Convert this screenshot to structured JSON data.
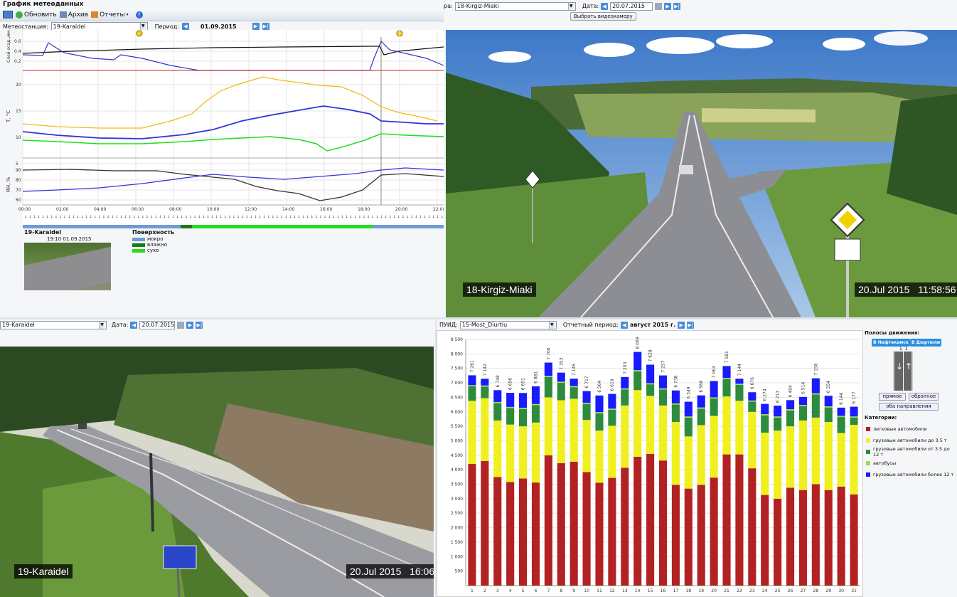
{
  "meteo": {
    "title": "График метеоданных",
    "toolbar": {
      "refresh": "Обновить",
      "archive": "Архив",
      "reports": "Отчеты"
    },
    "station_label": "Метеостанция:",
    "station": "19-Karaidel",
    "period_label": "Период:",
    "period": "01.09.2015",
    "axis1": "Слой осад.,мм",
    "axis2": "T, °C",
    "axis3": "RH, %",
    "times": [
      "00:00",
      "02:00",
      "04:00",
      "06:00",
      "08:00",
      "10:00",
      "12:00",
      "14:00",
      "16:00",
      "18:00",
      "20:00",
      "22:00"
    ],
    "y1": [
      "0.6",
      "0.4",
      "0.2"
    ],
    "y2": [
      "20",
      "15",
      "10",
      "5"
    ],
    "y3": [
      "90",
      "80",
      "70",
      "60"
    ],
    "info": {
      "station": "19-Karaidel",
      "time": "19:10 01.09.2015"
    },
    "legend": {
      "title": "Поверхность",
      "items": [
        {
          "label": "мокро",
          "color": "#6f9bd8"
        },
        {
          "label": "влажно",
          "color": "#1a7a1a"
        },
        {
          "label": "сухо",
          "color": "#22dd22"
        }
      ]
    }
  },
  "cam1": {
    "label_prefix": "ра:",
    "camera": "18-Kirgiz-Miaki",
    "date_label": "Дата:",
    "date": "20.07.2015",
    "select_btn": "Выбрать видеокамеру",
    "overlay_name": "18-Kirgiz-Miaki",
    "overlay_date": "20.Jul 2015",
    "overlay_time": "11:58:56"
  },
  "cam2": {
    "camera": "19-Karaidel",
    "date_label": "Дата:",
    "date": "20.07.2015",
    "overlay_name": "19-Karaidel",
    "overlay_date": "20.Jul 2015",
    "overlay_time": "16:06:29"
  },
  "traffic": {
    "station_label": "ПУИД:",
    "station": "15-Most_Diurtiu",
    "period_label": "Отчетный период:",
    "period": "август 2015 г.",
    "lanes_title": "Полосы движения:",
    "dir1": "В Нефтекамск",
    "dir2": "В Дюртюли",
    "lane_nums": [
      "1",
      "1"
    ],
    "btn_forward": "прямое",
    "btn_back": "обратное",
    "btn_both": "оба направления",
    "cat_title": "Категории:",
    "categories": [
      {
        "label": "легковые автомобили",
        "color": "#b22222"
      },
      {
        "label": "грузовые автомобили до 3.5 т",
        "color": "#f0f020"
      },
      {
        "label": "грузовые автомобили от 3.5 до 12 т",
        "color": "#2e8b3e"
      },
      {
        "label": "автобусы",
        "color": "#99dd55"
      },
      {
        "label": "грузовые автомобили более 12 т",
        "color": "#1a1aff"
      }
    ],
    "y_ticks": [
      "8 500",
      "8 000",
      "7 500",
      "7 000",
      "6 500",
      "6 000",
      "5 500",
      "5 000",
      "4 500",
      "4 000",
      "3 500",
      "3 000",
      "2 500",
      "2 000",
      "1 500",
      "1 000",
      "500"
    ]
  },
  "chart_data": {
    "type": "bar",
    "stacked": true,
    "ylim": [
      0,
      8500
    ],
    "categories": [
      "1",
      "2",
      "3",
      "4",
      "5",
      "6",
      "7",
      "8",
      "9",
      "10",
      "11",
      "12",
      "13",
      "14",
      "15",
      "16",
      "17",
      "18",
      "19",
      "20",
      "21",
      "22",
      "23",
      "24",
      "25",
      "26",
      "27",
      "28",
      "29",
      "30",
      "31"
    ],
    "totals": [
      "7 261",
      "7 142",
      "6 748",
      "6 656",
      "6 651",
      "6 881",
      "7 700",
      "7 353",
      "7 145",
      "6 717",
      "6 564",
      "6 619",
      "7 203",
      "8 069",
      "7 628",
      "7 257",
      "6 738",
      "6 349",
      "6 568",
      "7 063",
      "7 581",
      "7 144",
      "6 676",
      "6 274",
      "6 213",
      "6 404",
      "6 514",
      "7 158",
      "6 554",
      "6 144",
      "6 177"
    ],
    "series": [
      {
        "name": "легковые автомобили",
        "values": [
          4200,
          4300,
          3750,
          3580,
          3700,
          3560,
          4500,
          4230,
          4280,
          3920,
          3550,
          3720,
          4070,
          4450,
          4550,
          4320,
          3480,
          3350,
          3480,
          3730,
          4530,
          4530,
          4050,
          3130,
          3000,
          3380,
          3300,
          3500,
          3300,
          3420,
          3150
        ]
      },
      {
        "name": "грузовые автомобили до 3.5 т",
        "values": [
          2180,
          2170,
          1950,
          1980,
          1800,
          2070,
          2000,
          2170,
          2170,
          1800,
          1800,
          1800,
          2150,
          2300,
          2000,
          1900,
          2170,
          1800,
          2060,
          2130,
          2000,
          1850,
          1950,
          2150,
          2350,
          2120,
          2400,
          2300,
          2350,
          1850,
          2400
        ]
      },
      {
        "name": "грузовые автомобили от 3.5 до 12 т",
        "values": [
          500,
          400,
          600,
          570,
          600,
          600,
          700,
          600,
          400,
          550,
          600,
          550,
          550,
          650,
          400,
          550,
          600,
          650,
          570,
          600,
          600,
          550,
          350,
          600,
          450,
          550,
          500,
          800,
          500,
          550,
          250
        ]
      },
      {
        "name": "автобусы",
        "values": [
          40,
          40,
          40,
          40,
          40,
          40,
          40,
          40,
          40,
          40,
          40,
          40,
          40,
          40,
          40,
          40,
          40,
          40,
          40,
          40,
          40,
          40,
          40,
          40,
          40,
          40,
          40,
          40,
          40,
          40,
          40
        ]
      },
      {
        "name": "грузовые автомобили более 12 т",
        "values": [
          341,
          232,
          408,
          486,
          511,
          611,
          460,
          313,
          255,
          407,
          574,
          509,
          393,
          629,
          638,
          447,
          448,
          509,
          418,
          563,
          411,
          174,
          286,
          354,
          373,
          314,
          274,
          518,
          364,
          284,
          337
        ]
      }
    ]
  }
}
